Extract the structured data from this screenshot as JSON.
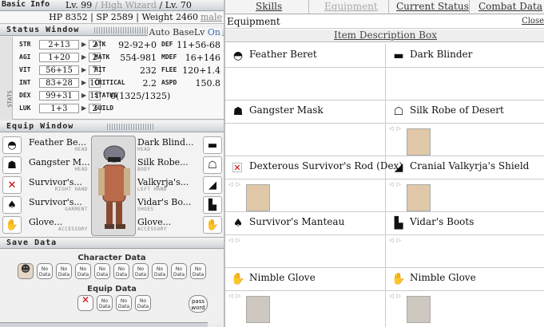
{
  "basic_info": {
    "title": "Basic Info",
    "level": "Lv. 99",
    "job": "High Wizard",
    "job_level": "Lv. 70",
    "sep": "/",
    "hp": "HP 8352",
    "sp": "SP 2589",
    "weight": "Weight 2460",
    "gender": "male"
  },
  "status_window": {
    "title": "Status Window",
    "auto_base_label": "Auto BaseLv",
    "auto_base_value": "On",
    "side_label": "STATS",
    "stats": [
      {
        "name": "STR",
        "value": "2+13",
        "points": "2",
        "d1": "ATK",
        "v1": "92-92+0",
        "d2": "DEF",
        "v2": "11+56-68"
      },
      {
        "name": "AGI",
        "value": "1+20",
        "points": "2",
        "d1": "MATK",
        "v1": "554-981",
        "d2": "MDEF",
        "v2": "16+146"
      },
      {
        "name": "VIT",
        "value": "56+15",
        "points": "7",
        "d1": "HIT",
        "v1": "232",
        "d2": "FLEE",
        "v2": "120+1.4"
      },
      {
        "name": "INT",
        "value": "83+28",
        "points": "10",
        "d1": "CRITICAL",
        "v1": "2.2",
        "d2": "ASPD",
        "v2": "150.8"
      },
      {
        "name": "DEX",
        "value": "99+31",
        "points": "11",
        "d1": "STATUS",
        "v1": "0(1325/1325)",
        "d2": "",
        "v2": ""
      },
      {
        "name": "LUK",
        "value": "1+3",
        "points": "2",
        "d1": "GUILD",
        "v1": "",
        "d2": "",
        "v2": ""
      }
    ]
  },
  "equip_window": {
    "title": "Equip Window",
    "left": [
      {
        "name": "Feather Be...",
        "pos": "HEAD",
        "icon": "feather-beret-icon"
      },
      {
        "name": "Gangster M...",
        "pos": "HEAD",
        "icon": "gangster-mask-icon"
      },
      {
        "name": "Survivor's...",
        "pos": "RIGHT HAND",
        "icon": "rod-icon"
      },
      {
        "name": "Survivor's...",
        "pos": "GARMENT",
        "icon": "manteau-icon"
      },
      {
        "name": "Glove...",
        "pos": "ACCESSORY",
        "icon": "glove-icon"
      }
    ],
    "right": [
      {
        "name": "Dark Blind...",
        "pos": "HEAD",
        "icon": "dark-blinder-icon"
      },
      {
        "name": "Silk Robe...",
        "pos": "BODY",
        "icon": "silk-robe-icon"
      },
      {
        "name": "Valkyrja's...",
        "pos": "LEFT HAND",
        "icon": "shield-icon"
      },
      {
        "name": "Vidar's Bo...",
        "pos": "SHOES",
        "icon": "boots-icon"
      },
      {
        "name": "Glove...",
        "pos": "ACCESSORY",
        "icon": "glove-icon"
      }
    ]
  },
  "save_data": {
    "title": "Save Data",
    "character_label": "Character Data",
    "equip_label": "Equip Data",
    "no_data": "No Data",
    "password": "pass word"
  },
  "tabs": [
    {
      "label": "Skills"
    },
    {
      "label": "Equipment"
    },
    {
      "label": "Current Status"
    },
    {
      "label": "Combat Data"
    }
  ],
  "equipment_panel": {
    "title": "Equipment",
    "close": "Close",
    "desc_box": "Item Description Box",
    "items": [
      {
        "name": "Feather Beret",
        "icon": "feather-beret-icon"
      },
      {
        "name": "Dark Blinder",
        "icon": "dark-blinder-icon"
      },
      {
        "name": "Gangster Mask",
        "icon": "gangster-mask-icon"
      },
      {
        "name": "Silk Robe of Desert",
        "icon": "silk-robe-icon"
      },
      {
        "name": "Dexterous Survivor's Rod (Dex)",
        "icon": "missing-image-icon"
      },
      {
        "name": "Cranial Valkyrja's Shield",
        "icon": "shield-icon"
      },
      {
        "name": "Survivor's Manteau",
        "icon": "manteau-icon"
      },
      {
        "name": "Vidar's Boots",
        "icon": "boots-icon"
      },
      {
        "name": "Nimble Glove",
        "icon": "glove-icon"
      },
      {
        "name": "Nimble Glove",
        "icon": "glove-icon"
      }
    ]
  }
}
